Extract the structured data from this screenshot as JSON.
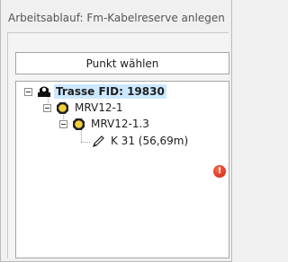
{
  "workflow": {
    "title": "Arbeitsablauf: Fm-Kabelreserve anlegen"
  },
  "toolbar": {
    "select_point_label": "Punkt wählen"
  },
  "tree": {
    "root": {
      "label": "Trasse FID: 19830",
      "icon": "manhole-icon",
      "selected": true
    },
    "child1": {
      "label": "MRV12-1",
      "icon": "closure-icon"
    },
    "child2": {
      "label": "MRV12-1.3",
      "icon": "closure-icon"
    },
    "leaf": {
      "label": "K 31 (56,69m)",
      "icon": "cable-pencil-icon"
    }
  },
  "status": {
    "icon": "error-icon",
    "color": "#d0300f"
  },
  "colors": {
    "selection": "#cce8ff",
    "closure_fill": "#f2cf3a"
  }
}
